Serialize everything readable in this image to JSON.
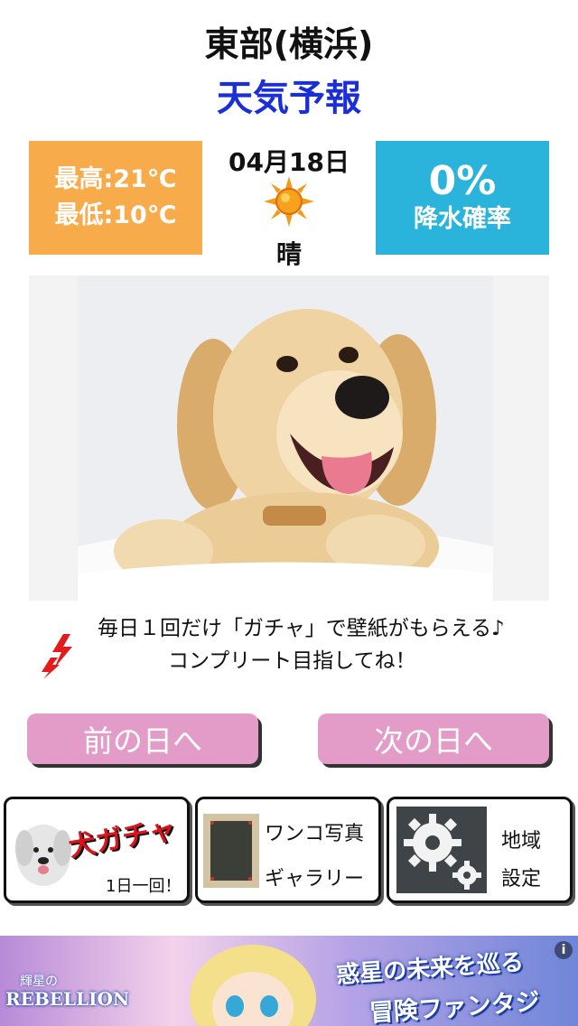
{
  "header": {
    "region": "東部(横浜)",
    "subtitle": "天気予報"
  },
  "forecast": {
    "high": "最高:21℃",
    "low": "最低:10℃",
    "date": "04月18日",
    "condition": "晴",
    "condition_icon": "sun-icon",
    "precip_value": "0%",
    "precip_label": "降水確率",
    "colors": {
      "temp_box": "#f7ab4a",
      "precip_box": "#2ab3db"
    }
  },
  "wallpaper": {
    "subject": "golden-retriever-puppy"
  },
  "message": {
    "line1": "毎日１回だけ「ガチャ」で壁紙がもらえる♪",
    "line2": "コンプリート目指してね！"
  },
  "nav": {
    "prev_label": "前の日へ",
    "next_label": "次の日へ",
    "button_color": "#e39cc8"
  },
  "menu": {
    "gacha_title": "犬ガチャ",
    "gacha_sub": "1日一回！",
    "gallery_line1": "ワンコ写真",
    "gallery_line2": "ギャラリー",
    "region_line1": "地域",
    "region_line2": "設定"
  },
  "ad": {
    "logo": "REBELLION",
    "logo_small": "輝星の",
    "tagline1": "惑星の未来を巡る",
    "tagline2": "冒険ファンタジー！",
    "info": "i"
  }
}
